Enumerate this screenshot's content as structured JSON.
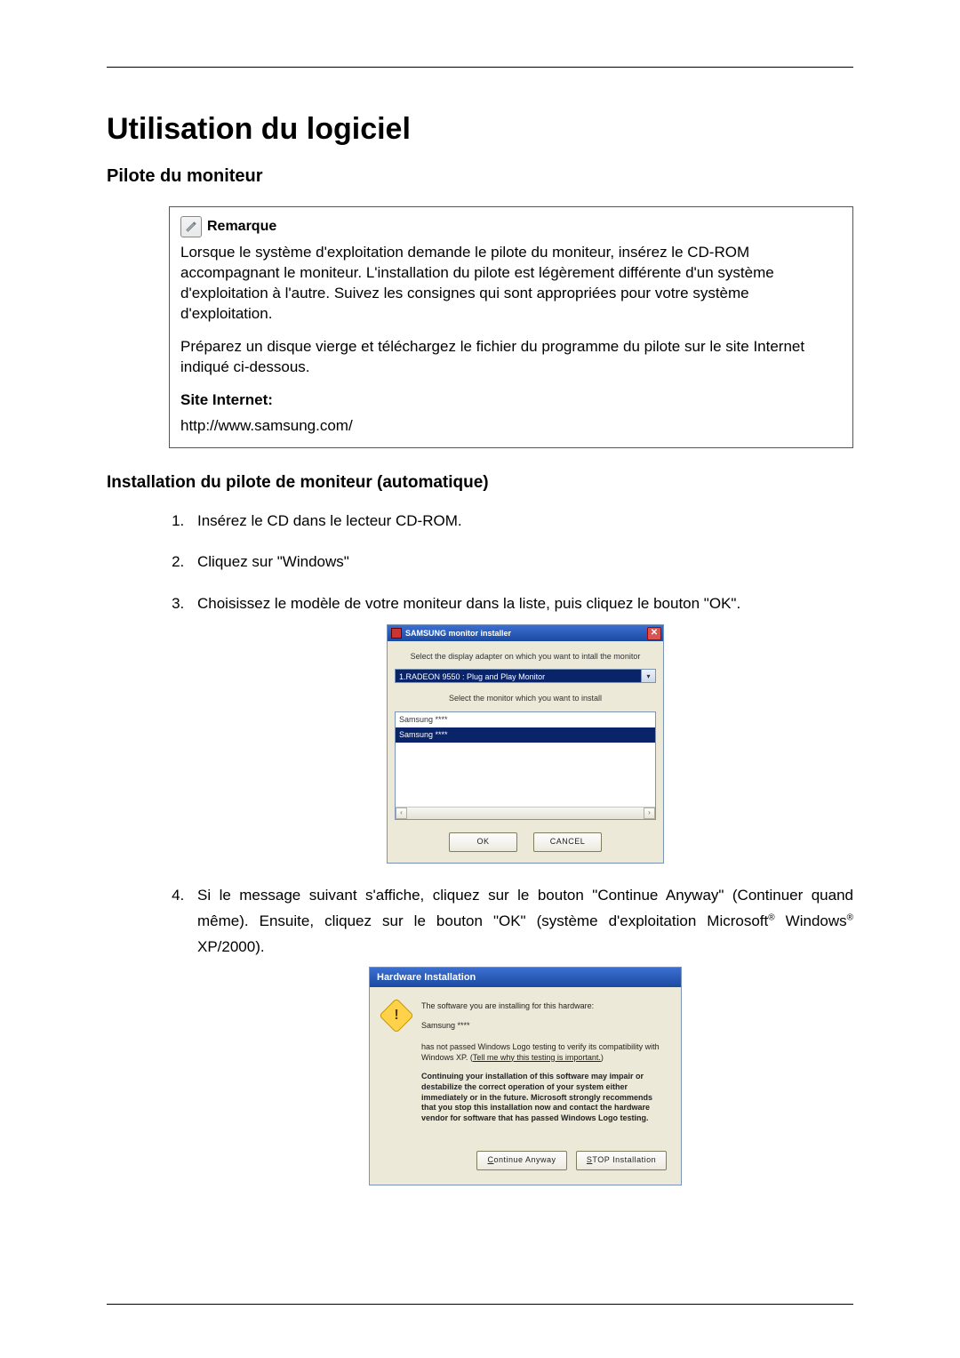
{
  "title": "Utilisation du logiciel",
  "section1_heading": "Pilote du moniteur",
  "note": {
    "label": "Remarque",
    "p1": "Lorsque le système d'exploitation demande le pilote du moniteur, insérez le CD-ROM accompagnant le moniteur. L'installation du pilote est légèrement différente d'un système d'exploitation à l'autre. Suivez les consignes qui sont appropriées pour votre système d'exploitation.",
    "p2": "Préparez un disque vierge et téléchargez le fichier du programme du pilote sur le site Internet indiqué ci-dessous.",
    "site_label": "Site Internet:",
    "url": "http://www.samsung.com/"
  },
  "section2_heading": "Installation du pilote de moniteur (automatique)",
  "steps": {
    "s1": "Insérez le CD dans le lecteur CD-ROM.",
    "s2": "Cliquez sur \"Windows\"",
    "s3": "Choisissez le modèle de votre moniteur dans la liste, puis cliquez le bouton \"OK\".",
    "s4a": "Si le message suivant s'affiche, cliquez sur le bouton \"Continue Anyway\" (Continuer quand même). Ensuite, cliquez sur le bouton \"OK\" (système d'exploitation Microsoft",
    "s4b": " Windows",
    "s4c": " XP/2000)."
  },
  "installer": {
    "title": "SAMSUNG monitor installer",
    "instr1": "Select the display adapter on which you want to intall the monitor",
    "adapter_selected": "1.RADEON 9550 : Plug and Play Monitor",
    "instr2": "Select the monitor which you want to install",
    "list_item_1": "Samsung ****",
    "list_item_2": "Samsung ****",
    "ok": "OK",
    "cancel": "CANCEL"
  },
  "hw": {
    "title": "Hardware Installation",
    "line1": "The software you are installing for this hardware:",
    "device": "Samsung ****",
    "line2a": "has not passed Windows Logo testing to verify its compatibility with Windows XP. (",
    "link": "Tell me why this testing is important.",
    "line2b": ")",
    "bold": "Continuing your installation of this software may impair or destabilize the correct operation of your system either immediately or in the future. Microsoft strongly recommends that you stop this installation now and contact the hardware vendor for software that has passed Windows Logo testing.",
    "continue_u": "C",
    "continue_rest": "ontinue Anyway",
    "stop_u": "S",
    "stop_rest": "TOP Installation"
  }
}
